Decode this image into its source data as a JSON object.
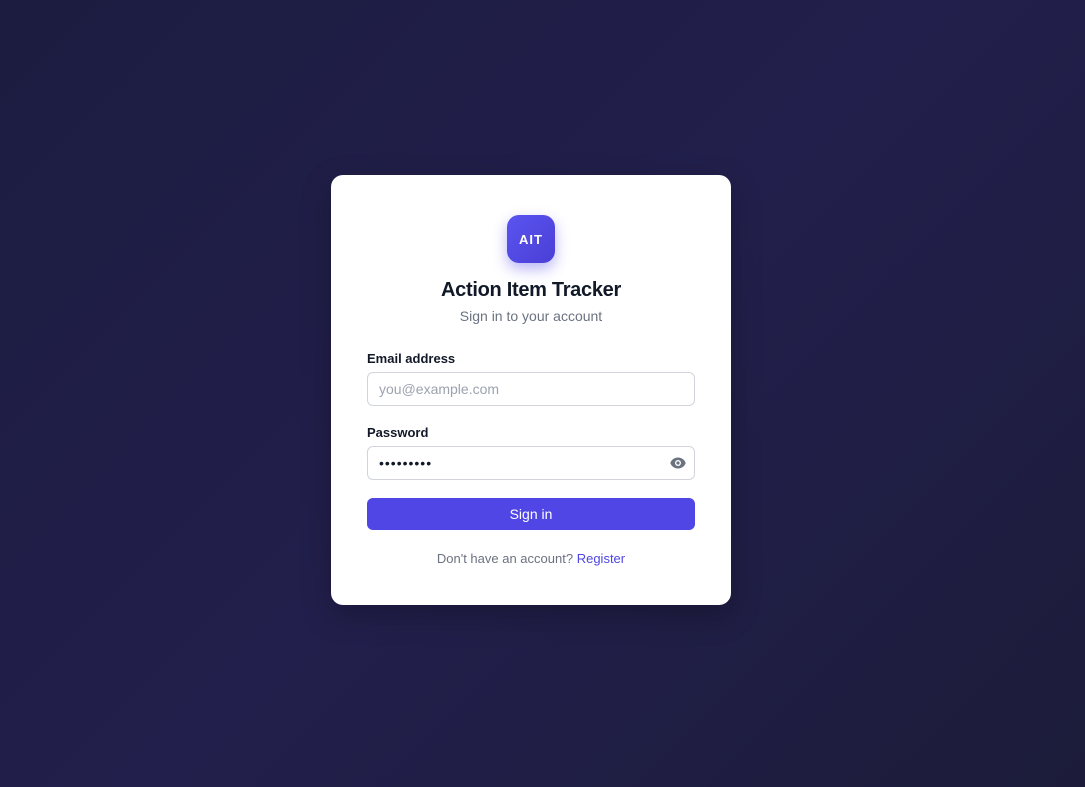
{
  "app": {
    "logo_text": "AIT",
    "title": "Action Item Tracker",
    "subtitle": "Sign in to your account"
  },
  "form": {
    "email_label": "Email address",
    "email_placeholder": "you@example.com",
    "email_value": "",
    "password_label": "Password",
    "password_value": "password1",
    "show_password_icon": "eye-icon",
    "submit_label": "Sign in"
  },
  "footer": {
    "prompt_text": "Don't have an account?",
    "register_link": "Register"
  },
  "colors": {
    "accent": "#4f46e5",
    "background": "#1e1c44",
    "card": "#ffffff"
  }
}
